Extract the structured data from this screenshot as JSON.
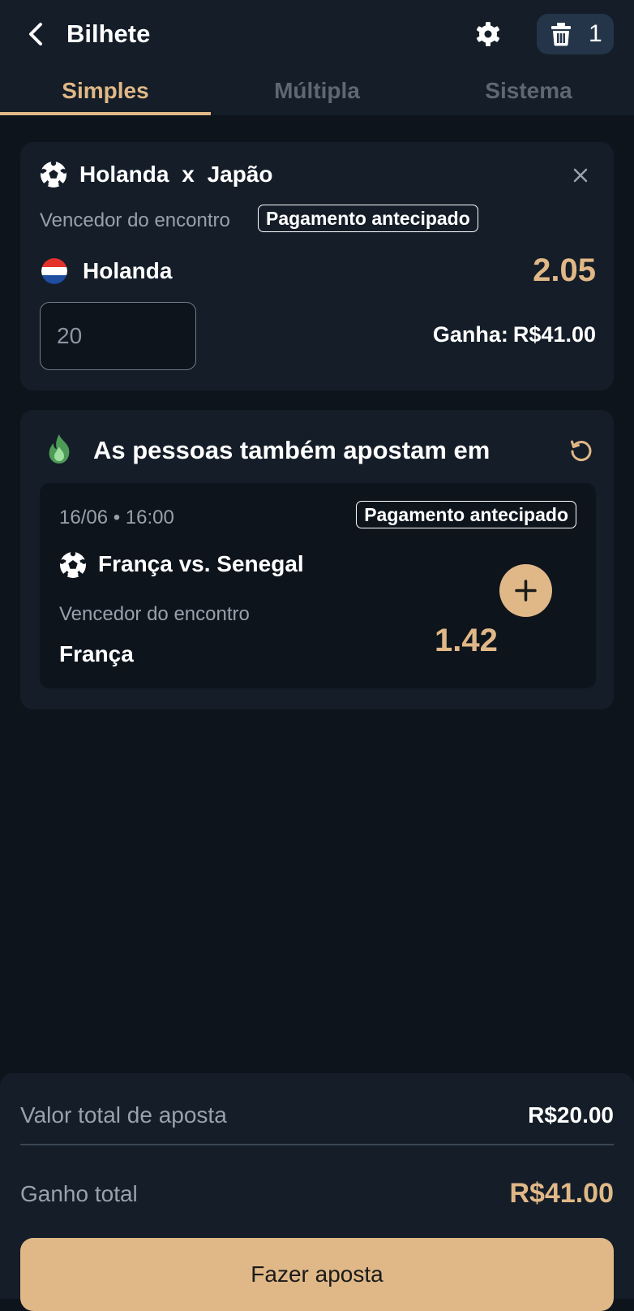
{
  "header": {
    "title": "Bilhete",
    "bet_count": "1"
  },
  "tabs": [
    {
      "label": "Simples",
      "active": true
    },
    {
      "label": "Múltipla",
      "active": false
    },
    {
      "label": "Sistema",
      "active": false
    }
  ],
  "bet": {
    "home_team": "Holanda",
    "separator": "x",
    "away_team": "Japão",
    "market": "Vencedor do encontro",
    "badge": "Pagamento antecipado",
    "selection": "Holanda",
    "odds": "2.05",
    "stake_value": "20",
    "win_label": "Ganha:",
    "win_amount": "R$41.00"
  },
  "suggestion": {
    "title": "As pessoas também apostam em",
    "date_time": "16/06 • 16:00",
    "badge": "Pagamento antecipado",
    "match": "França vs. Senegal",
    "market": "Vencedor do encontro",
    "selection": "França",
    "odds": "1.42"
  },
  "summary": {
    "stake_label": "Valor total de aposta",
    "stake_value": "R$20.00",
    "win_label": "Ganho total",
    "win_value": "R$41.00",
    "place_bet_label": "Fazer aposta"
  },
  "colors": {
    "accent": "#e0b887",
    "background": "#0e141c",
    "card": "#141d28",
    "muted_text": "#98a1ac"
  }
}
